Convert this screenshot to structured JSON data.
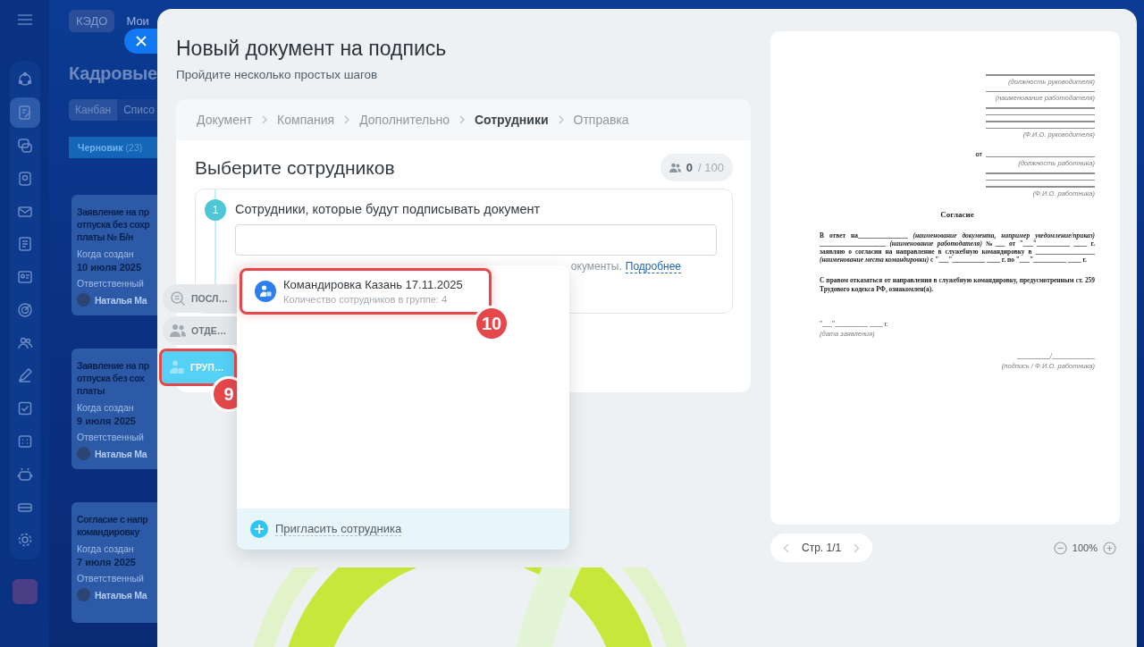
{
  "sidebar": {
    "items": [
      {
        "selected": false
      },
      {
        "selected": true
      },
      {
        "selected": false
      },
      {
        "selected": false
      },
      {
        "selected": false
      },
      {
        "selected": false
      },
      {
        "selected": false
      },
      {
        "selected": false
      },
      {
        "selected": false
      },
      {
        "selected": false
      },
      {
        "selected": false
      },
      {
        "selected": false
      },
      {
        "selected": false
      },
      {
        "selected": false
      },
      {
        "selected": false
      }
    ]
  },
  "background_app": {
    "tabs": [
      {
        "label": "КЭДО",
        "selected": true
      },
      {
        "label": "Мои",
        "selected": false
      }
    ],
    "title": "Кадровые",
    "views": [
      {
        "label": "Канбан",
        "selected": true
      },
      {
        "label": "Списо",
        "selected": false
      }
    ],
    "column": {
      "title": "Черновик",
      "count": "(23)"
    },
    "cards": [
      {
        "title_lines": [
          "Заявление на пр",
          "отпуска без сохр",
          "платы № Б/н"
        ],
        "created_label": "Когда создан",
        "created": "10 июля 2025",
        "owner_label": "Ответственный",
        "owner": "Наталья Ма"
      },
      {
        "title_lines": [
          "Заявление на пр",
          "отпуска без сох",
          "платы"
        ],
        "created_label": "Когда создан",
        "created": "9 июля 2025",
        "owner_label": "Ответственный",
        "owner": "Наталья Ма"
      },
      {
        "title_lines": [
          "Согласие с напр",
          "командировку"
        ],
        "created_label": "Когда создан",
        "created": "7 июля 2025",
        "owner_label": "Ответственный",
        "owner": "Наталья Ма"
      }
    ]
  },
  "dialog": {
    "title": "Новый документ на подпись",
    "subtitle": "Пройдите несколько простых шагов"
  },
  "wizard": {
    "steps": [
      {
        "label": "Документ",
        "selected": false
      },
      {
        "label": "Компания",
        "selected": false
      },
      {
        "label": "Дополнительно",
        "selected": false
      },
      {
        "label": "Сотрудники",
        "selected": true
      },
      {
        "label": "Отправка",
        "selected": false
      }
    ],
    "heading": "Выберите сотрудников",
    "counter": {
      "value": "0",
      "limit": "/ 100"
    },
    "section": {
      "number": "1",
      "title": "Сотрудники, которые будут подписывать документ",
      "hint": "окументы.",
      "link": "Подробнее"
    }
  },
  "picker": {
    "tabs": [
      {
        "label": "ПОСЛ…",
        "selected": false,
        "highlighted": false
      },
      {
        "label": "ОТДЕ…",
        "selected": false,
        "highlighted": false
      },
      {
        "label": "ГРУП…",
        "selected": true,
        "highlighted": true,
        "badge": "9"
      }
    ],
    "items": [
      {
        "title": "Командировка Казань 17.11.2025",
        "subtitle": "Количество сотрудников в группе: 4",
        "highlighted": true,
        "badge": "10"
      }
    ],
    "footer": "Пригласить сотрудника"
  },
  "preview": {
    "header": [
      {
        "kind": "rule"
      },
      {
        "kind": "caption",
        "text": "(должность руководителя)"
      },
      {
        "kind": "rule"
      },
      {
        "kind": "caption",
        "text": "(наименование работодателя)"
      },
      {
        "kind": "rule"
      },
      {
        "kind": "rule"
      },
      {
        "kind": "rule"
      },
      {
        "kind": "rule"
      },
      {
        "kind": "caption",
        "text": "(Ф.И.О. руководителя)"
      },
      {
        "kind": "from_rule",
        "text": "от"
      },
      {
        "kind": "caption",
        "text": "(должность работника)"
      },
      {
        "kind": "rule"
      },
      {
        "kind": "rule"
      },
      {
        "kind": "rule"
      },
      {
        "kind": "caption",
        "text": "(Ф.И.О. работника)"
      }
    ],
    "title": "Согласие",
    "paragraphs": [
      "В ответ на_______________ *(наименование документа, например уведомление/приказ)* ____________________ *(наименование работодателя)* №___ от \"___\"__________ ____ г. заявляю о согласии на направление в служебную командировку в __________________ *(наименование места командировки)* с \"___\"__________ ____ г. по \"___\"__________ ____ г.",
      "С правом отказаться от направления в служебную командировку, предусмотренным ст. 259 Трудового кодекса РФ, ознакомлен(а)."
    ],
    "date": "\"___\"__________ ____ г.",
    "date_caption": "(дата заявления)",
    "signature": "__________/_____________",
    "signature_caption": "(подпись / Ф.И.О. работника)"
  },
  "pager": {
    "label": "Стр. 1/1"
  },
  "zoom": {
    "value": "100%"
  }
}
